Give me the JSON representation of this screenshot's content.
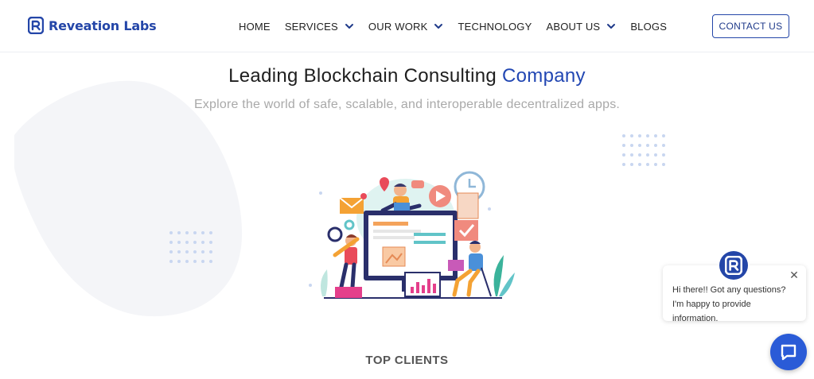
{
  "brand": {
    "name": "Reveation Labs",
    "color": "#2446a8"
  },
  "nav": {
    "items": [
      {
        "label": "HOME",
        "dropdown": false
      },
      {
        "label": "SERVICES",
        "dropdown": true
      },
      {
        "label": "OUR WORK",
        "dropdown": true
      },
      {
        "label": "TECHNOLOGY",
        "dropdown": false
      },
      {
        "label": "ABOUT US",
        "dropdown": true
      },
      {
        "label": "BLOGS",
        "dropdown": false
      }
    ],
    "contact_label": "CONTACT US"
  },
  "hero": {
    "title_main": "Leading Blockchain Consulting ",
    "title_accent": "Company",
    "subtitle": "Explore the world of safe, scalable, and interoperable decentralized apps."
  },
  "sections": {
    "clients_heading": "TOP CLIENTS"
  },
  "chat": {
    "message": "Hi there!! Got any questions? I'm happy to provide information.",
    "icons": [
      "brand-logo-icon",
      "close-icon",
      "chat-icon"
    ],
    "accent": "#2a5bd7"
  },
  "illustration": "team-working-on-dashboard-illustration"
}
